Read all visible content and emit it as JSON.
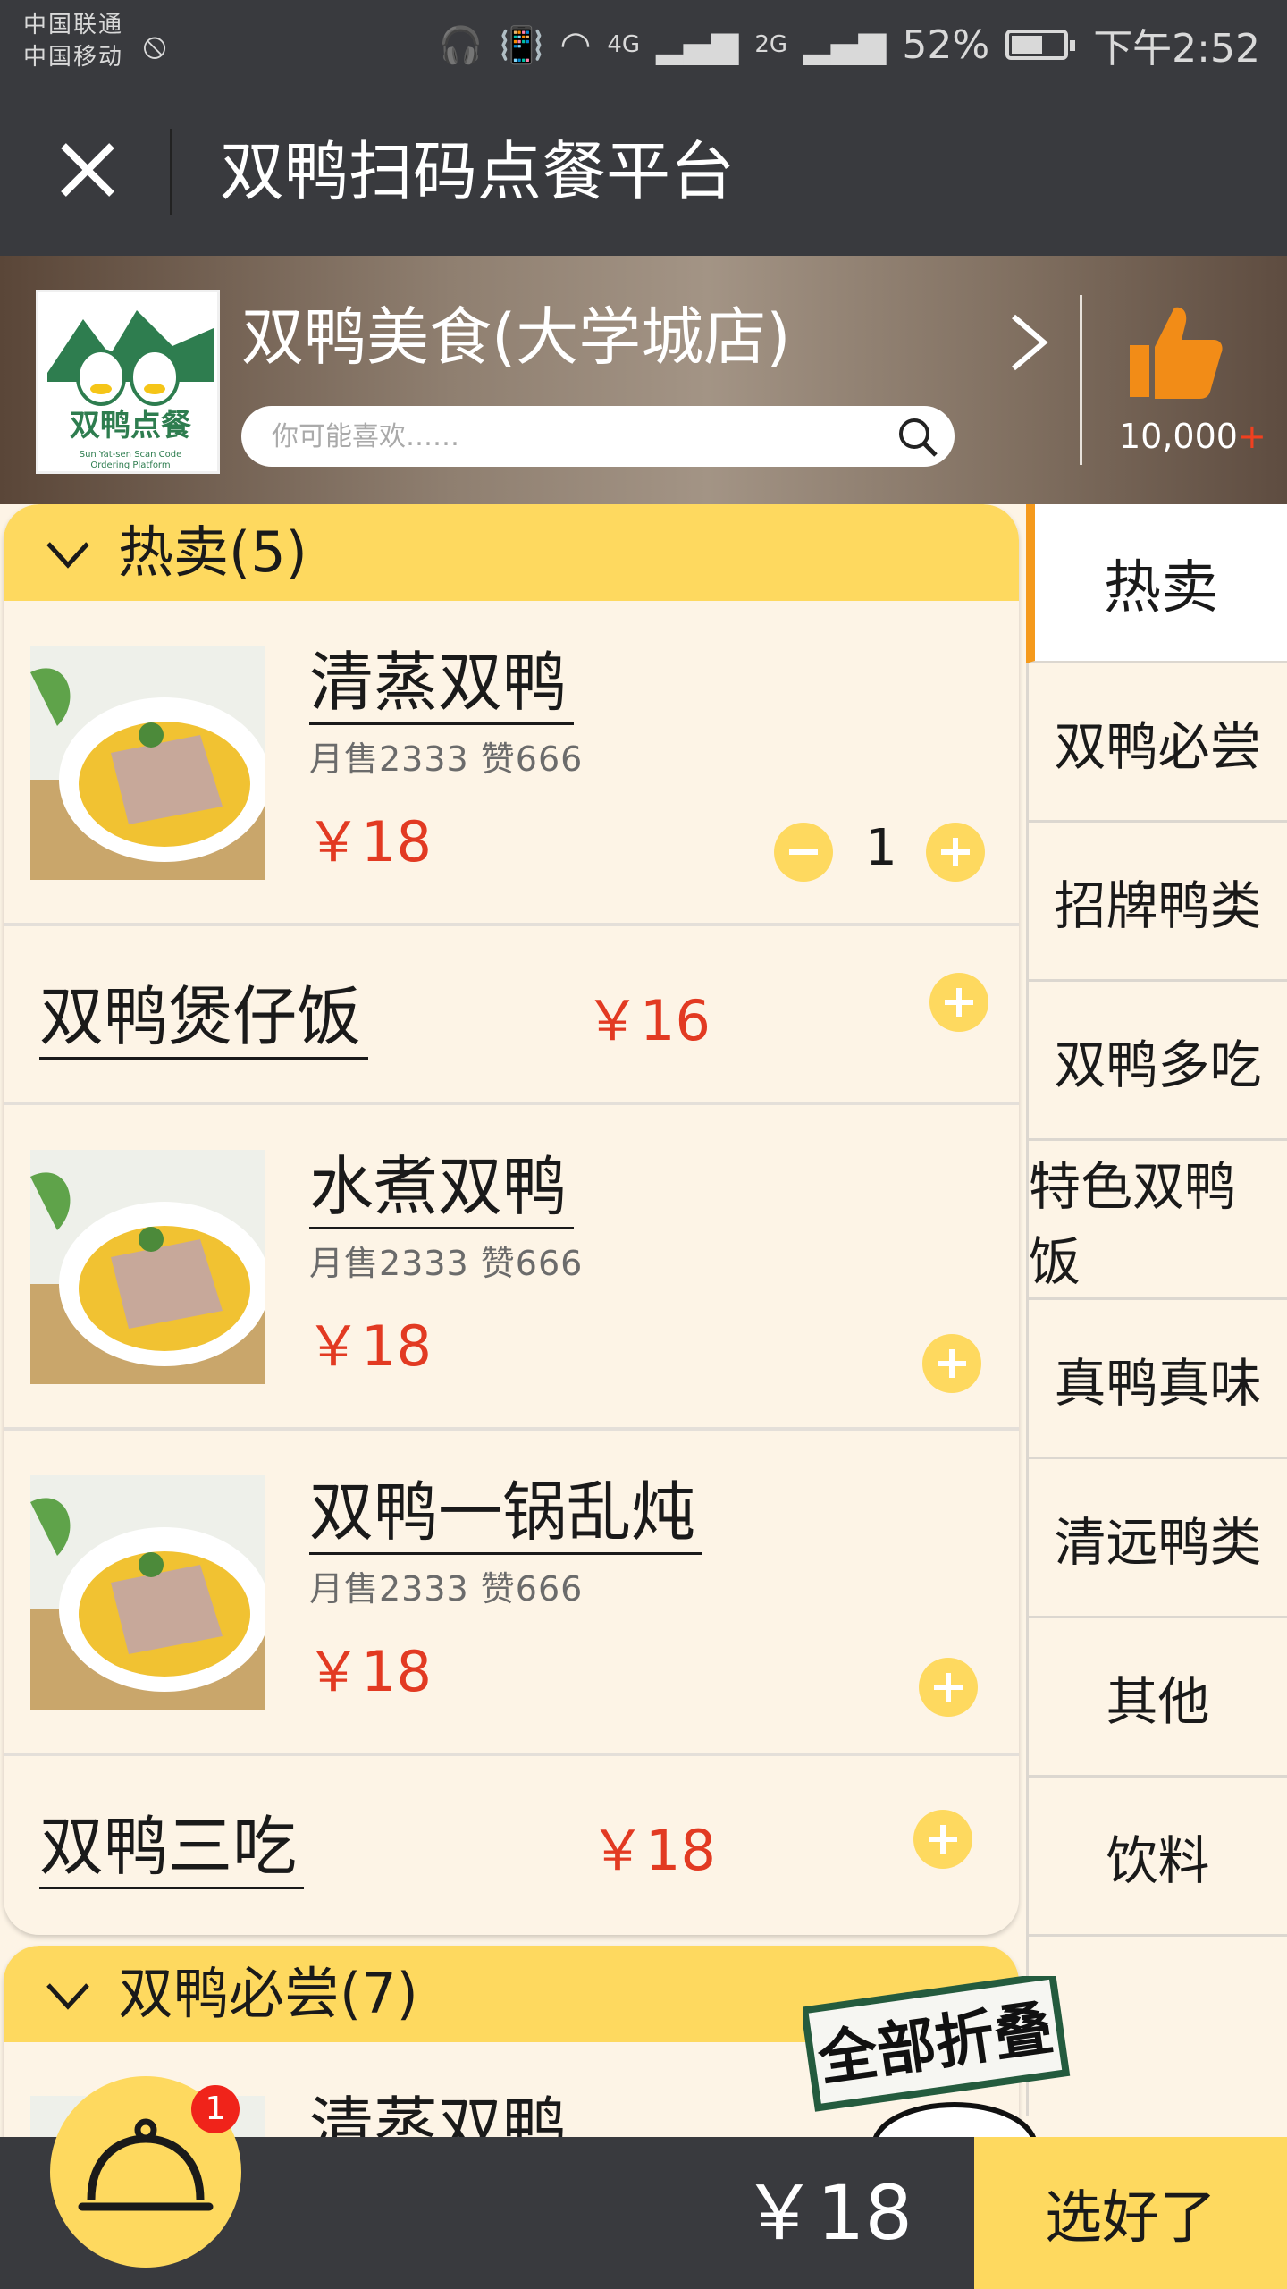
{
  "status_bar": {
    "carrier_1": "中国联通",
    "carrier_2": "中国移动",
    "net_4g": "4G",
    "net_2g": "2G",
    "battery": "52%",
    "time": "下午2:52"
  },
  "titlebar": {
    "title": "双鸭扫码点餐平台"
  },
  "store": {
    "name": "双鸭美食(大学城店)",
    "search_placeholder": "你可能喜欢……",
    "like_count": "10,000",
    "like_plus": "+"
  },
  "sections": [
    {
      "title": "热卖(5)",
      "dishes": [
        {
          "name": "清蒸双鸭",
          "sales": "月售2333 赞666",
          "price": "￥18",
          "qty": "1"
        },
        {
          "name": "双鸭煲仔饭",
          "price": "￥16"
        },
        {
          "name": "水煮双鸭",
          "sales": "月售2333 赞666",
          "price": "￥18"
        },
        {
          "name": "双鸭一锅乱炖",
          "sales": "月售2333 赞666",
          "price": "￥18"
        },
        {
          "name": "双鸭三吃",
          "price": "￥18"
        }
      ]
    },
    {
      "title": "双鸭必尝(7)",
      "dishes": [
        {
          "name": "清蒸双鸭"
        }
      ]
    }
  ],
  "categories": [
    "热卖",
    "双鸭必尝",
    "招牌鸭类",
    "双鸭多吃",
    "特色双鸭饭",
    "真鸭真味",
    "清远鸭类",
    "其他",
    "饮料"
  ],
  "collapse_label": "全部折叠",
  "cart": {
    "total": "￥18",
    "checkout": "选好了",
    "badge": "1"
  },
  "colors": {
    "dark_bar": "#393a3e",
    "accent_yellow": "#fed95f",
    "price_red": "#e23a22",
    "background": "#fdf4e6",
    "active_category_marker": "#f59a1c"
  }
}
